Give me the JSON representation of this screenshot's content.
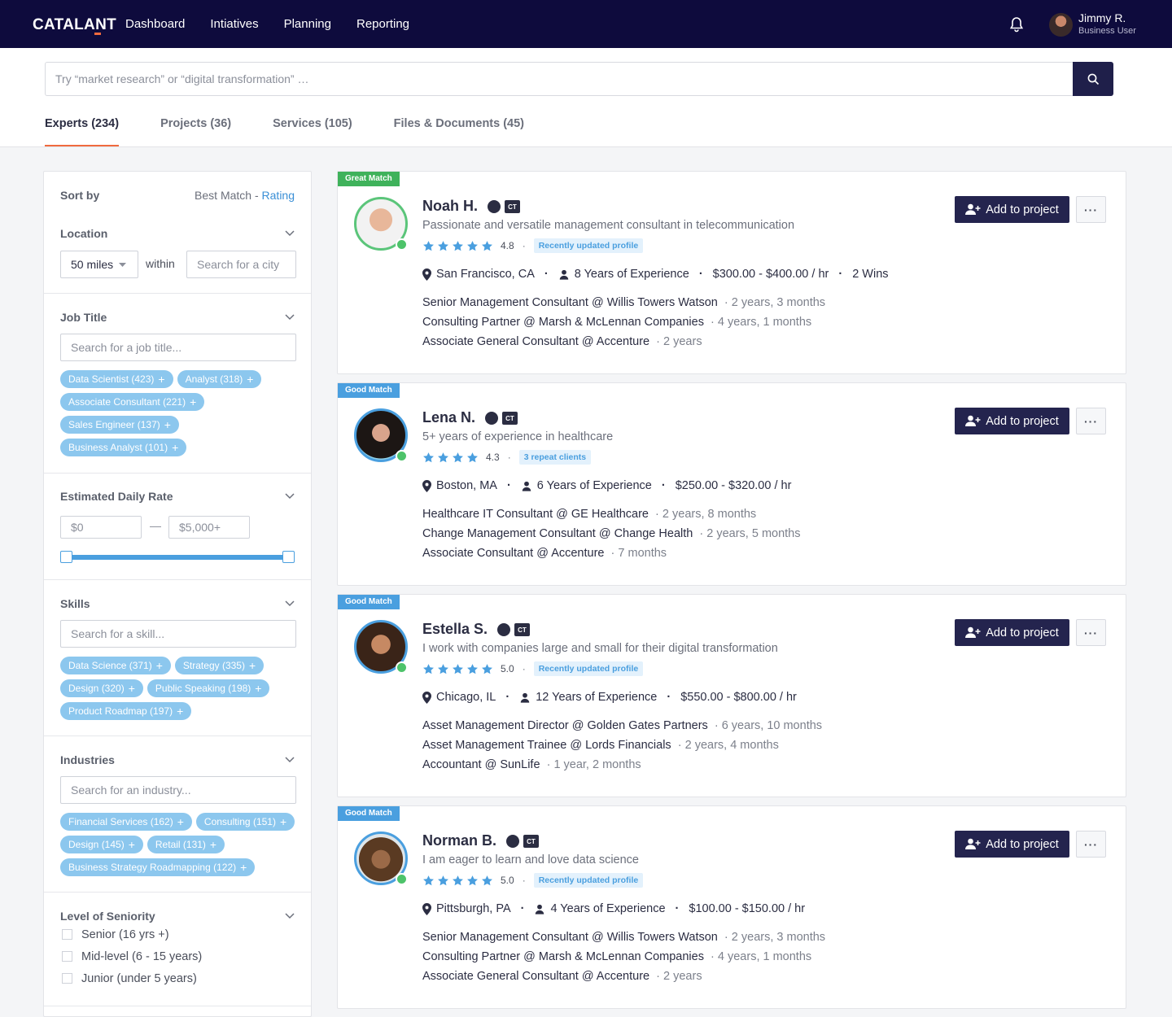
{
  "app": {
    "logo": "CATALANT"
  },
  "nav": [
    "Dashboard",
    "Intiatives",
    "Planning",
    "Reporting"
  ],
  "user": {
    "name": "Jimmy R.",
    "role": "Business User"
  },
  "search": {
    "placeholder": "Try “market research” or “digital transformation” …"
  },
  "tabs": [
    "Experts (234)",
    "Projects (36)",
    "Services (105)",
    "Files & Documents (45)"
  ],
  "sidebar": {
    "sort_label": "Sort by",
    "sort_best": "Best Match",
    "sort_sep": " - ",
    "sort_rating": "Rating",
    "location": {
      "title": "Location",
      "distance": "50 miles",
      "within": "within",
      "city_placeholder": "Search for a city"
    },
    "job_title": {
      "title": "Job Title",
      "placeholder": "Search for a job title...",
      "chips": [
        "Data Scientist (423)",
        "Analyst (318)",
        "Associate Consultant (221)",
        "Sales Engineer (137)",
        "Business Analyst (101)"
      ]
    },
    "rate": {
      "title": "Estimated Daily Rate",
      "min_placeholder": "$0",
      "max_placeholder": "$5,000+",
      "dash": "—"
    },
    "skills": {
      "title": "Skills",
      "placeholder": "Search for a skill...",
      "chips": [
        "Data Science (371)",
        "Strategy (335)",
        "Design (320)",
        "Public Speaking (198)",
        "Product Roadmap (197)"
      ]
    },
    "industries": {
      "title": "Industries",
      "placeholder": "Search for an industry...",
      "chips": [
        "Financial Services (162)",
        "Consulting (151)",
        "Design (145)",
        "Retail (131)",
        "Business Strategy Roadmapping (122)"
      ]
    },
    "seniority": {
      "title": "Level of Seniority",
      "options": [
        "Senior (16 yrs +)",
        "Mid-level (6 - 15 years)",
        "Junior (under 5 years)"
      ]
    }
  },
  "cards": [
    {
      "badge": "Great Match",
      "name": "Noah H.",
      "tagline": "Passionate and versatile management consultant in telecommunication",
      "rating": "4.8",
      "pill": "Recently updated profile",
      "location": "San Francisco, CA",
      "experience": "8 Years of Experience",
      "rate": "$300.00 - $400.00 / hr",
      "wins": "2 Wins",
      "history": [
        {
          "role": "Senior Management Consultant @ Willis Towers Watson",
          "dur": "2 years, 3 months"
        },
        {
          "role": "Consulting Partner @ Marsh & McLennan Companies",
          "dur": "4 years, 1 months"
        },
        {
          "role": "Associate General Consultant @ Accenture",
          "dur": "2 years"
        }
      ]
    },
    {
      "badge": "Good Match",
      "name": "Lena N.",
      "tagline": "5+ years of experience in healthcare",
      "rating": "4.3",
      "pill": "3 repeat clients",
      "location": "Boston, MA",
      "experience": "6 Years of Experience",
      "rate": "$250.00 - $320.00 / hr",
      "wins": "",
      "history": [
        {
          "role": "Healthcare IT Consultant @ GE Healthcare",
          "dur": "2 years, 8 months"
        },
        {
          "role": "Change Management Consultant @ Change Health",
          "dur": "2 years, 5 months"
        },
        {
          "role": "Associate Consultant @ Accenture",
          "dur": "7 months"
        }
      ]
    },
    {
      "badge": "Good Match",
      "name": "Estella S.",
      "tagline": "I work with companies large and small for their digital transformation",
      "rating": "5.0",
      "pill": "Recently updated profile",
      "location": "Chicago, IL",
      "experience": "12 Years of Experience",
      "rate": "$550.00 - $800.00 / hr",
      "wins": "",
      "history": [
        {
          "role": "Asset Management Director @ Golden Gates Partners",
          "dur": "6 years, 10 months"
        },
        {
          "role": "Asset Management Trainee @ Lords Financials",
          "dur": "2 years, 4 months"
        },
        {
          "role": "Accountant @ SunLife",
          "dur": "1 year, 2 months"
        }
      ]
    },
    {
      "badge": "Good Match",
      "name": "Norman B.",
      "tagline": "I am eager to learn and love data science",
      "rating": "5.0",
      "pill": "Recently updated profile",
      "location": "Pittsburgh, PA",
      "experience": "4 Years of Experience",
      "rate": "$100.00 - $150.00 / hr",
      "wins": "",
      "history": [
        {
          "role": "Senior Management Consultant @ Willis Towers Watson",
          "dur": "2 years, 3 months"
        },
        {
          "role": "Consulting Partner @ Marsh & McLennan Companies",
          "dur": "4 years, 1 months"
        },
        {
          "role": "Associate General Consultant @ Accenture",
          "dur": "2 years"
        }
      ]
    }
  ],
  "card_ct_label": "CT",
  "add_label": "Add to project",
  "more_label": "···",
  "colors": {
    "navy": "#0e0b3d",
    "accent": "#f06a3e",
    "chip": "#8cc7ee",
    "star": "#4a9fdf",
    "great": "#3fb25b",
    "good": "#4a9fdf"
  }
}
